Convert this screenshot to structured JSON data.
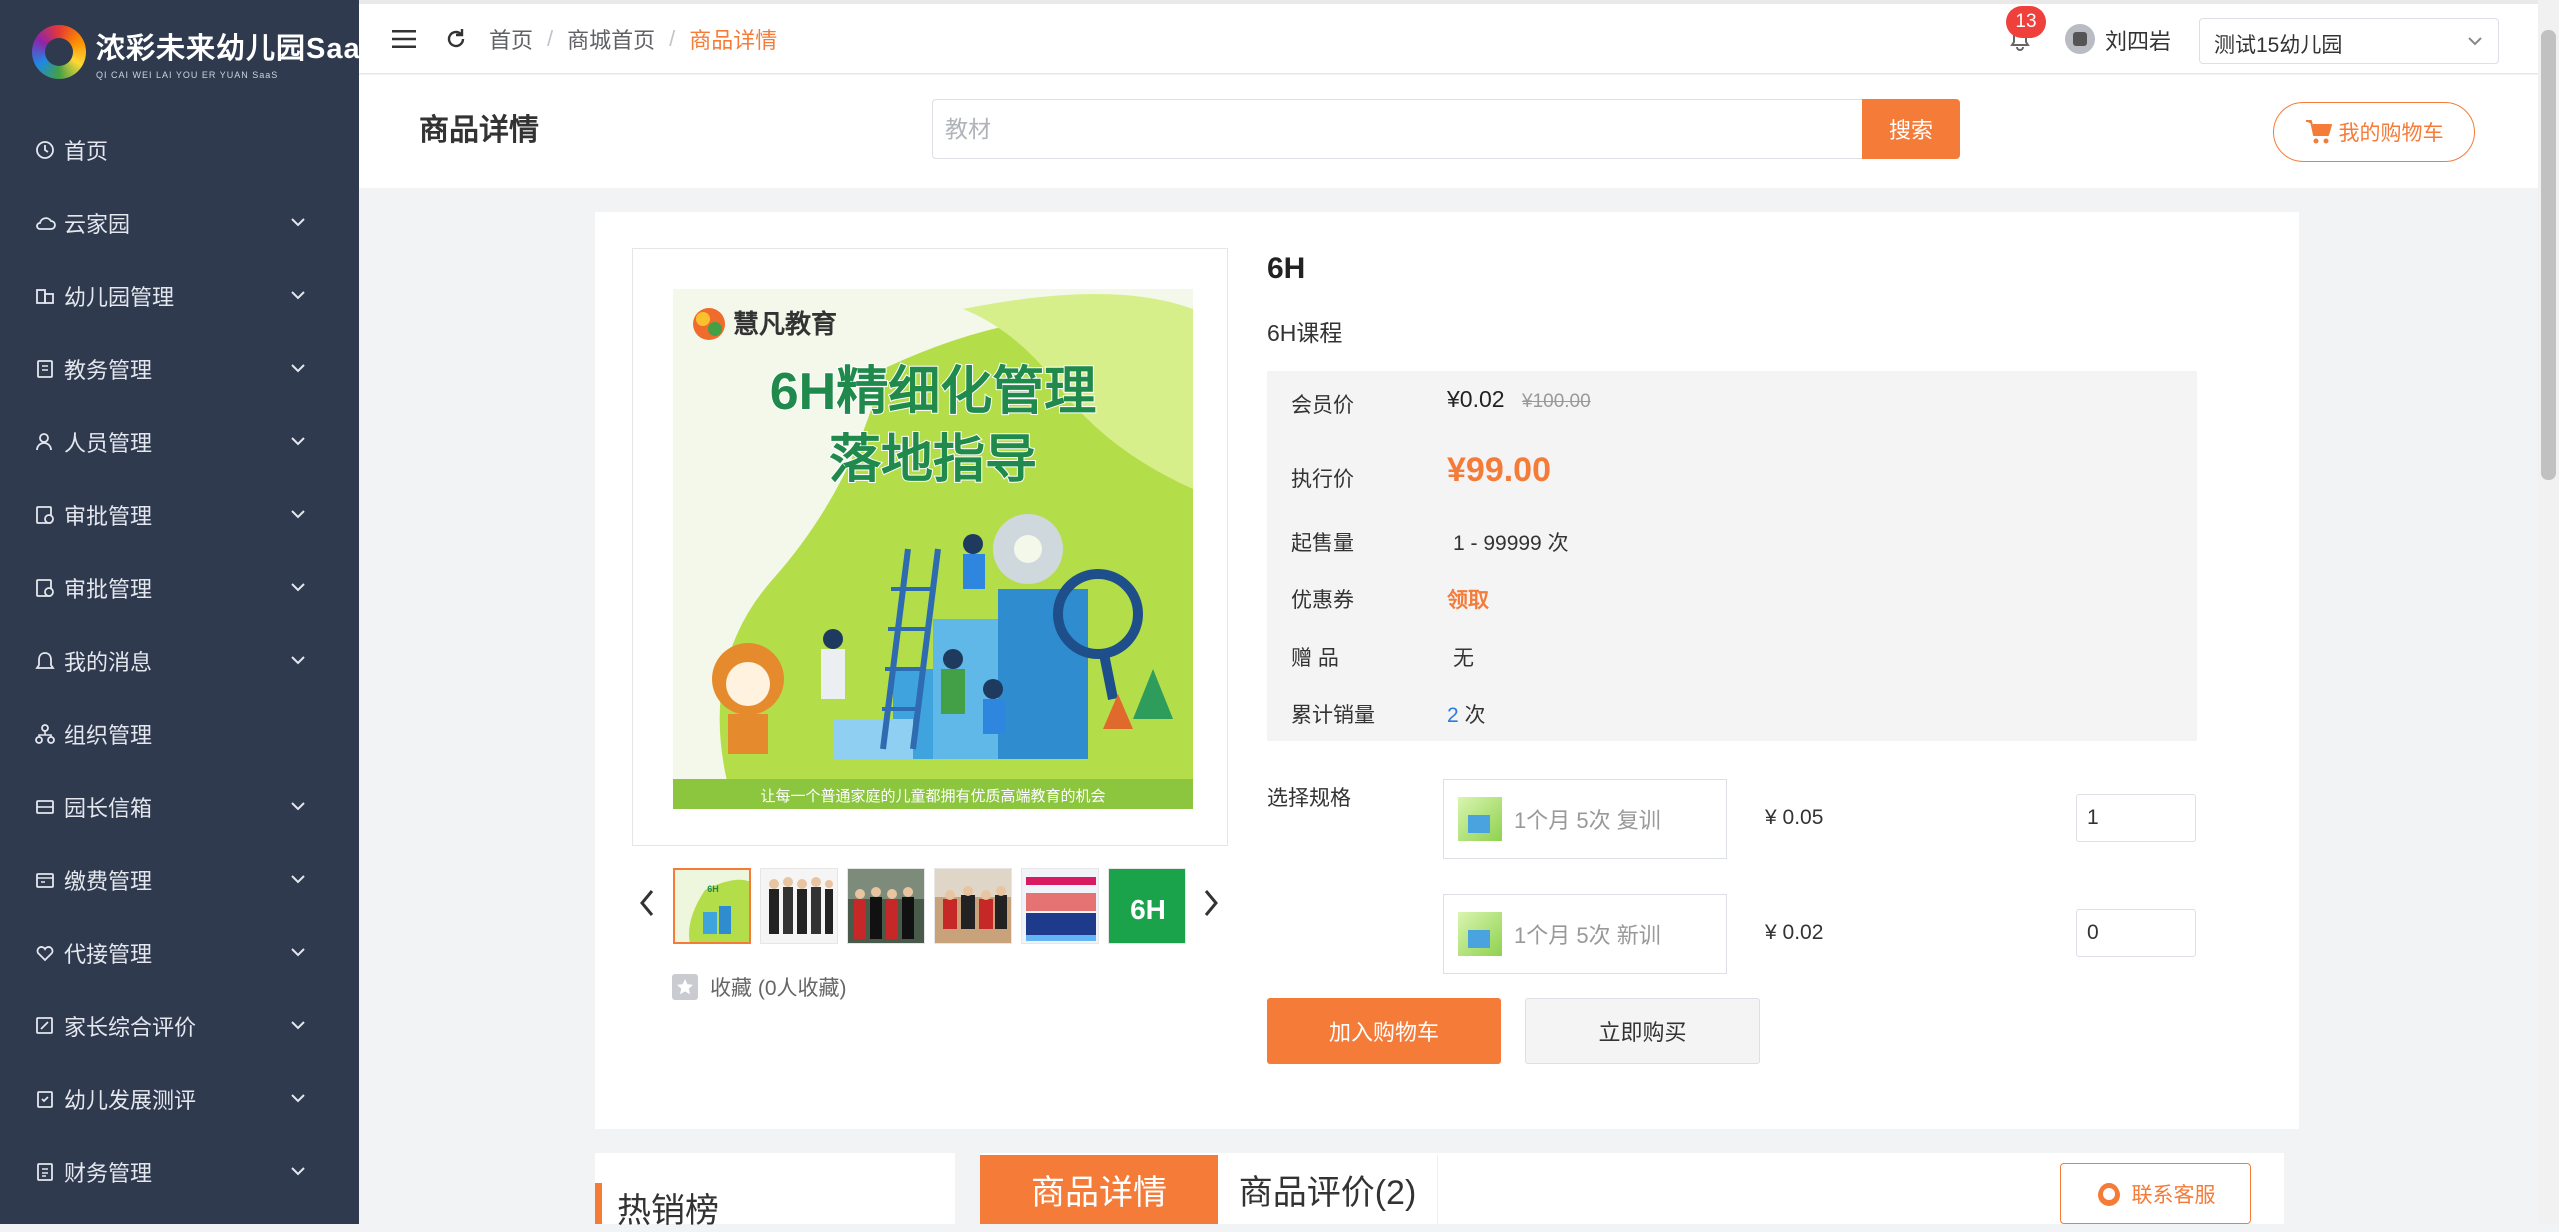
{
  "brand": {
    "name": "浓彩未来幼儿园SaaS",
    "subtitle": "QI CAI WEI LAI YOU ER YUAN SaaS"
  },
  "sidebar": {
    "items": [
      {
        "label": "首页",
        "icon": "clock-icon",
        "expandable": false
      },
      {
        "label": "云家园",
        "icon": "cloud-icon",
        "expandable": true
      },
      {
        "label": "幼儿园管理",
        "icon": "building-icon",
        "expandable": true
      },
      {
        "label": "教务管理",
        "icon": "book-icon",
        "expandable": true
      },
      {
        "label": "人员管理",
        "icon": "user-icon",
        "expandable": true
      },
      {
        "label": "审批管理",
        "icon": "approve-icon",
        "expandable": true
      },
      {
        "label": "审批管理",
        "icon": "approve-icon",
        "expandable": true
      },
      {
        "label": "我的消息",
        "icon": "bell-icon",
        "expandable": true
      },
      {
        "label": "组织管理",
        "icon": "org-icon",
        "expandable": false
      },
      {
        "label": "园长信箱",
        "icon": "mail-icon",
        "expandable": true
      },
      {
        "label": "缴费管理",
        "icon": "payment-icon",
        "expandable": true
      },
      {
        "label": "代接管理",
        "icon": "heart-icon",
        "expandable": true
      },
      {
        "label": "家长综合评价",
        "icon": "edit-icon",
        "expandable": true
      },
      {
        "label": "幼儿发展测评",
        "icon": "clipboard-icon",
        "expandable": true
      },
      {
        "label": "财务管理",
        "icon": "document-icon",
        "expandable": true
      }
    ]
  },
  "header": {
    "breadcrumb": [
      "首页",
      "商城首页",
      "商品详情"
    ],
    "notification_count": "13",
    "username": "刘四岩",
    "school": "测试15幼儿园"
  },
  "titlebar": {
    "title": "商品详情",
    "search_placeholder": "教材",
    "search_button": "搜索",
    "cart_button": "我的购物车"
  },
  "product": {
    "name": "6H",
    "subtitle": "6H课程",
    "image": {
      "brand": "慧凡教育",
      "headline_1": "6H精细化管理",
      "headline_2": "落地指导",
      "slogan": "让每一个普通家庭的儿童都拥有优质高端教育的机会"
    },
    "thumb_last_label": "6H",
    "favorite": "收藏 (0人收藏)",
    "member_price_label": "会员价",
    "member_price": "¥0.02",
    "original_price": "¥100.00",
    "exec_price_label": "执行价",
    "exec_price": "¥99.00",
    "min_qty_label": "起售量",
    "min_qty": "1 - 99999 次",
    "coupon_label": "优惠券",
    "coupon": "领取",
    "gift_label": "赠 品",
    "gift": "无",
    "sold_label": "累计销量",
    "sold_count": "2",
    "sold_unit": "次",
    "spec_label": "选择规格",
    "specs": [
      {
        "name": "1个月 5次 复训",
        "price": "¥ 0.05",
        "qty": "1"
      },
      {
        "name": "1个月 5次 新训",
        "price": "¥ 0.02",
        "qty": "0"
      }
    ],
    "add_to_cart": "加入购物车",
    "buy_now": "立即购买"
  },
  "bottom": {
    "hot_title": "热销榜",
    "tab_detail": "商品详情",
    "tab_review": "商品评价(2)",
    "service": "联系客服"
  },
  "colors": {
    "accent": "#f57c38",
    "sidebar_bg": "#2f3a4f",
    "badge": "#f0403c",
    "link_blue": "#2c7be5"
  }
}
